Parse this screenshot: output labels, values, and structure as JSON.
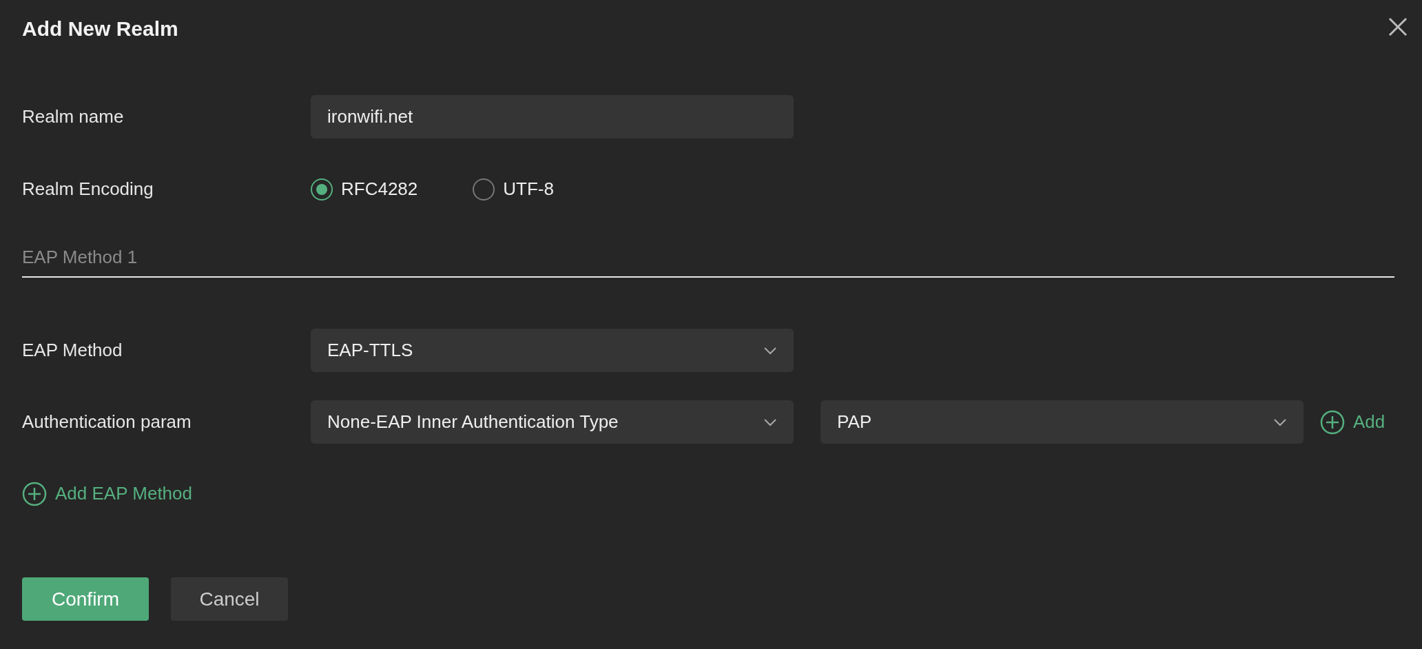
{
  "dialog": {
    "title": "Add New Realm"
  },
  "realm_name": {
    "label": "Realm name",
    "value": "ironwifi.net"
  },
  "realm_encoding": {
    "label": "Realm Encoding",
    "options": [
      {
        "label": "RFC4282",
        "selected": true
      },
      {
        "label": "UTF-8",
        "selected": false
      }
    ]
  },
  "section": {
    "title": "EAP Method 1"
  },
  "eap_method": {
    "label": "EAP Method",
    "value": "EAP-TTLS"
  },
  "auth_param": {
    "label": "Authentication param",
    "type_value": "None-EAP Inner Authentication Type",
    "value": "PAP",
    "add_label": "Add"
  },
  "add_eap_method": "Add EAP Method",
  "buttons": [
    {
      "label": "Confirm",
      "kind": "primary"
    },
    {
      "label": "Cancel",
      "kind": "secondary"
    }
  ]
}
